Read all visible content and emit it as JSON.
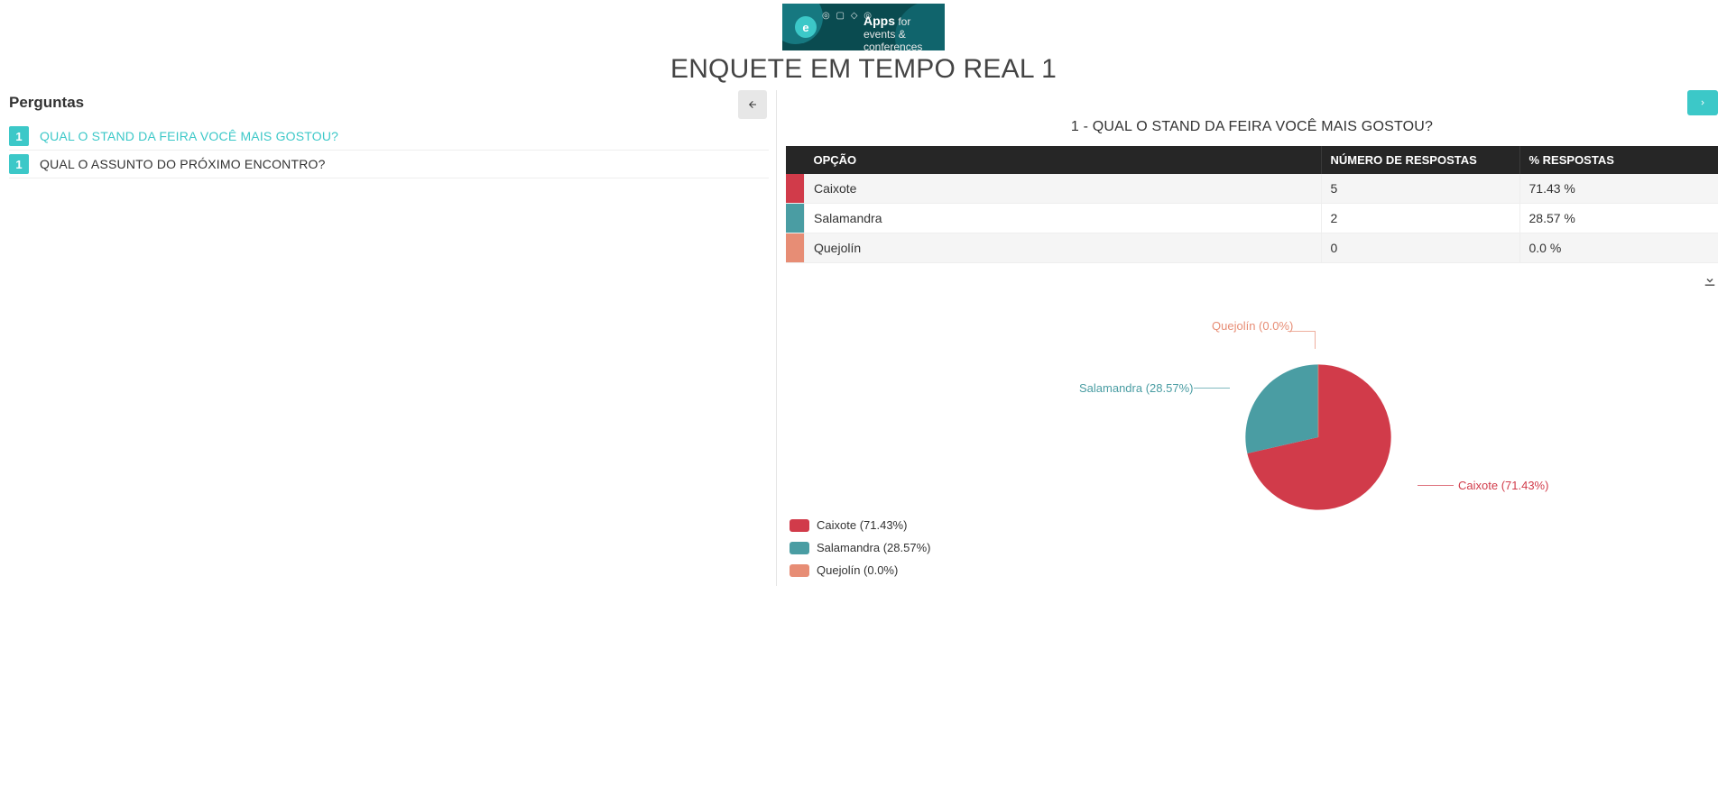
{
  "header": {
    "logo_app": "Apps",
    "logo_for": "for",
    "logo_sub": "events & conferences",
    "title": "ENQUETE EM TEMPO REAL 1"
  },
  "sidebar": {
    "heading": "Perguntas",
    "questions": [
      {
        "num": "1",
        "text": "QUAL O STAND DA FEIRA VOCÊ MAIS GOSTOU?",
        "active": true
      },
      {
        "num": "1",
        "text": "QUAL O ASSUNTO DO PRÓXIMO ENCONTRO?",
        "active": false
      }
    ]
  },
  "main": {
    "question_title": "1 - QUAL O STAND DA FEIRA VOCÊ MAIS GOSTOU?",
    "table": {
      "headers": {
        "option": "OPÇÃO",
        "count": "NÚMERO DE RESPOSTAS",
        "pct": "% RESPOSTAS"
      },
      "rows": [
        {
          "color": "#d13b4a",
          "option": "Caixote",
          "count": "5",
          "pct": "71.43 %"
        },
        {
          "color": "#4a9da3",
          "option": "Salamandra",
          "count": "2",
          "pct": "28.57 %"
        },
        {
          "color": "#e78d75",
          "option": "Quejolín",
          "count": "0",
          "pct": "0.0 %"
        }
      ]
    },
    "legend": [
      {
        "color": "#d13b4a",
        "label": "Caixote (71.43%)"
      },
      {
        "color": "#4a9da3",
        "label": "Salamandra (28.57%)"
      },
      {
        "color": "#e78d75",
        "label": "Quejolín (0.0%)"
      }
    ],
    "pie_labels": {
      "quejolin": "Quejolín (0.0%)",
      "salamandra": "Salamandra (28.57%)",
      "caixote": "Caixote (71.43%)"
    }
  },
  "chart_data": {
    "type": "pie",
    "title": "1 - QUAL O STAND DA FEIRA VOCÊ MAIS GOSTOU?",
    "series": [
      {
        "name": "Caixote",
        "value": 5,
        "pct": 71.43,
        "color": "#d13b4a"
      },
      {
        "name": "Salamandra",
        "value": 2,
        "pct": 28.57,
        "color": "#4a9da3"
      },
      {
        "name": "Quejolín",
        "value": 0,
        "pct": 0.0,
        "color": "#e78d75"
      }
    ]
  }
}
